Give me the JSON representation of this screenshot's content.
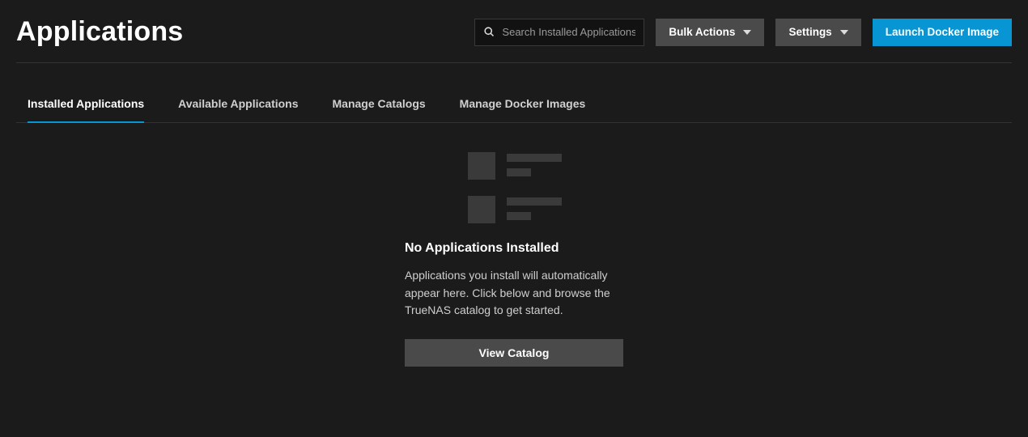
{
  "header": {
    "title": "Applications",
    "search_placeholder": "Search Installed Applications",
    "bulk_actions_label": "Bulk Actions",
    "settings_label": "Settings",
    "launch_label": "Launch Docker Image"
  },
  "tabs": [
    {
      "label": "Installed Applications",
      "active": true
    },
    {
      "label": "Available Applications",
      "active": false
    },
    {
      "label": "Manage Catalogs",
      "active": false
    },
    {
      "label": "Manage Docker Images",
      "active": false
    }
  ],
  "empty_state": {
    "title": "No Applications Installed",
    "description": "Applications you install will automatically appear here. Click below and browse the TrueNAS catalog to get started.",
    "button_label": "View Catalog"
  },
  "colors": {
    "accent": "#0795d3",
    "bg": "#1b1b1b",
    "btn": "#4a4a4a"
  }
}
